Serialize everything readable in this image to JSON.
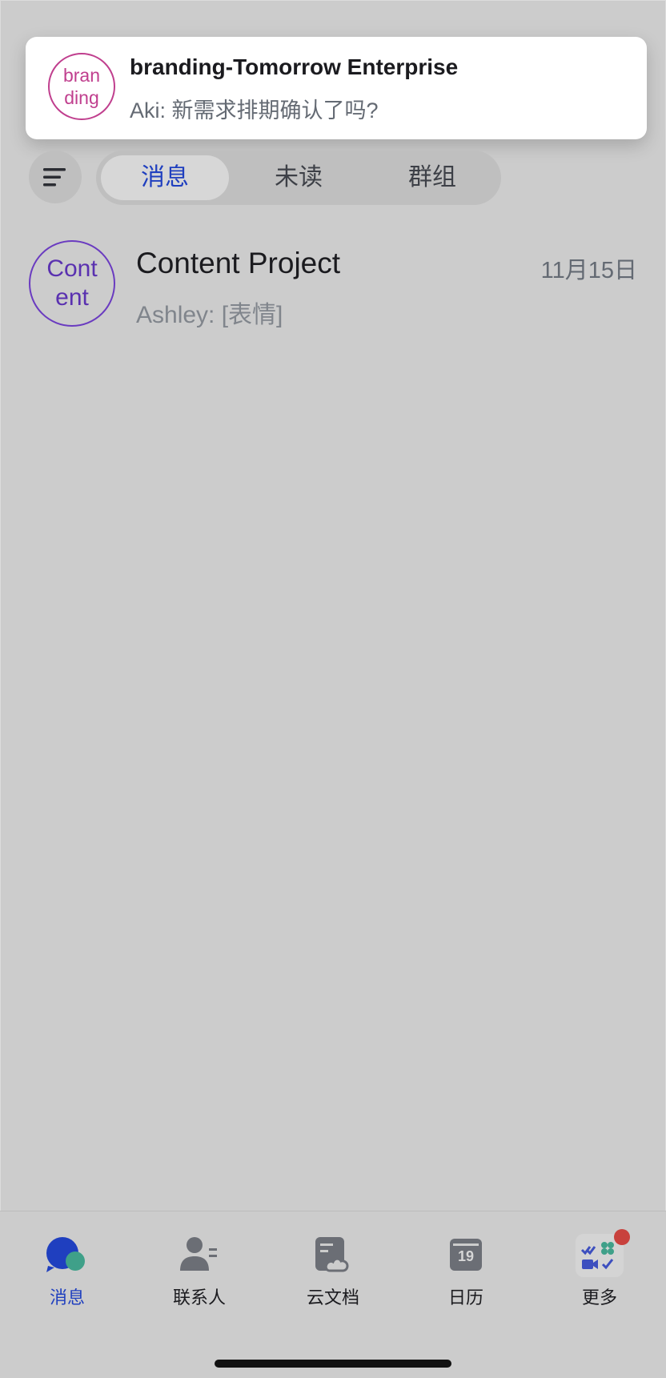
{
  "notification": {
    "avatar_text": "bran\nding",
    "title": "branding-Tomorrow Enterprise",
    "body": "Aki: 新需求排期确认了吗?"
  },
  "tabs": [
    {
      "label": "消息",
      "active": true
    },
    {
      "label": "未读",
      "active": false
    },
    {
      "label": "群组",
      "active": false
    }
  ],
  "chats": [
    {
      "avatar_text": "Cont\nent",
      "title": "Content Project",
      "time": "11月15日",
      "preview": "Ashley: [表情]"
    }
  ],
  "bottom_nav": [
    {
      "label": "消息",
      "icon": "chat-bubble-icon",
      "active": true
    },
    {
      "label": "联系人",
      "icon": "contacts-icon",
      "active": false
    },
    {
      "label": "云文档",
      "icon": "cloud-docs-icon",
      "active": false
    },
    {
      "label": "日历",
      "icon": "calendar-icon",
      "active": false,
      "icon_text": "19"
    },
    {
      "label": "更多",
      "icon": "more-apps-icon",
      "active": false,
      "badge": true
    }
  ],
  "colors": {
    "accent": "#1f3fbf",
    "badge": "#c8413d",
    "branding_avatar": "#c03f8e",
    "content_avatar": "#5a31b0"
  }
}
